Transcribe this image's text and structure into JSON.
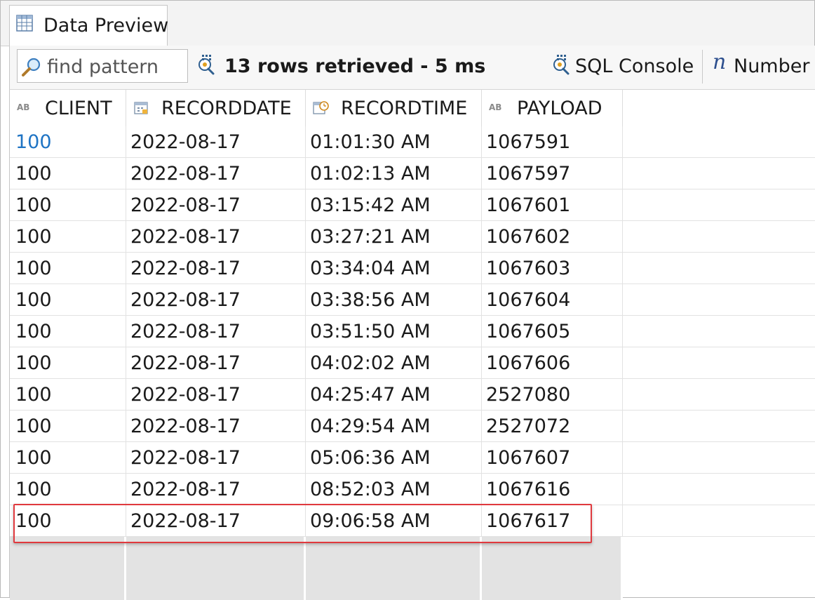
{
  "tab": {
    "label": "Data Preview",
    "icon": "table-icon"
  },
  "toolbar": {
    "search_placeholder": "find pattern",
    "search_icon": "magnifier-icon",
    "status_text": "13 rows retrieved - 5 ms",
    "sql_console_label": "SQL Console",
    "number_label": "Number",
    "number_icon_glyph": "n"
  },
  "columns": [
    {
      "label": "CLIENT",
      "type_badge": "AB",
      "icon": "text-type-icon"
    },
    {
      "label": "RECORDDATE",
      "type_badge": "",
      "icon": "date-type-icon"
    },
    {
      "label": "RECORDTIME",
      "type_badge": "",
      "icon": "time-type-icon"
    },
    {
      "label": "PAYLOAD",
      "type_badge": "AB",
      "icon": "text-type-icon"
    }
  ],
  "rows": [
    [
      "100",
      "2022-08-17",
      "01:01:30 AM",
      "1067591"
    ],
    [
      "100",
      "2022-08-17",
      "01:02:13 AM",
      "1067597"
    ],
    [
      "100",
      "2022-08-17",
      "03:15:42 AM",
      "1067601"
    ],
    [
      "100",
      "2022-08-17",
      "03:27:21 AM",
      "1067602"
    ],
    [
      "100",
      "2022-08-17",
      "03:34:04 AM",
      "1067603"
    ],
    [
      "100",
      "2022-08-17",
      "03:38:56 AM",
      "1067604"
    ],
    [
      "100",
      "2022-08-17",
      "03:51:50 AM",
      "1067605"
    ],
    [
      "100",
      "2022-08-17",
      "04:02:02 AM",
      "1067606"
    ],
    [
      "100",
      "2022-08-17",
      "04:25:47 AM",
      "2527080"
    ],
    [
      "100",
      "2022-08-17",
      "04:29:54 AM",
      "2527072"
    ],
    [
      "100",
      "2022-08-17",
      "05:06:36 AM",
      "1067607"
    ],
    [
      "100",
      "2022-08-17",
      "08:52:03 AM",
      "1067616"
    ],
    [
      "100",
      "2022-08-17",
      "09:06:58 AM",
      "1067617"
    ]
  ],
  "colors": {
    "selected_text": "#1f74c4",
    "highlight_border": "#e0393e",
    "empty_row": "#e3e3e3"
  }
}
